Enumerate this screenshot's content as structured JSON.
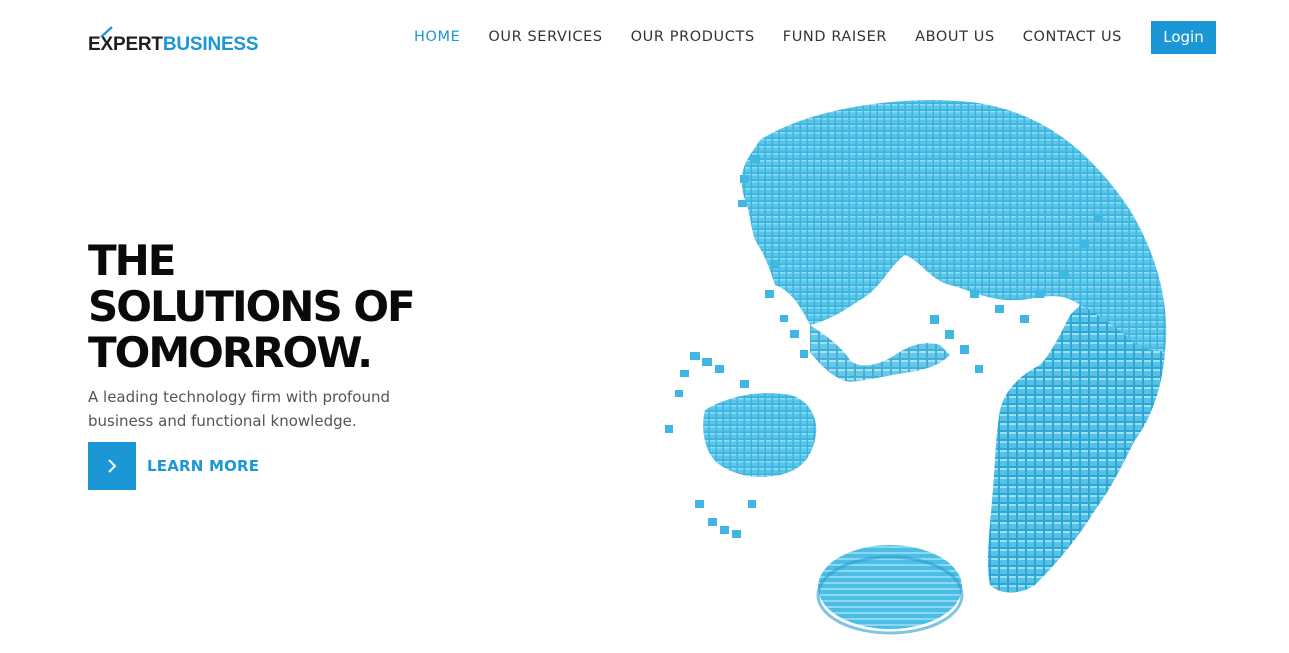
{
  "brand": {
    "logo_prefix_e": "E",
    "logo_prefix_x": "X",
    "logo_prefix_rest": "PERT",
    "logo_suffix": "BUSINESS",
    "colors": {
      "primary": "#1a97d4",
      "dark": "#1f1f1f"
    }
  },
  "nav": {
    "items": [
      {
        "label": "HOME",
        "active": true
      },
      {
        "label": "OUR SERVICES",
        "active": false
      },
      {
        "label": "OUR PRODUCTS",
        "active": false
      },
      {
        "label": "FUND RAISER",
        "active": false
      },
      {
        "label": "ABOUT US",
        "active": false
      },
      {
        "label": "CONTACT US",
        "active": false
      }
    ],
    "login_label": "Login"
  },
  "hero": {
    "title_lines": [
      "THE",
      "SOLUTIONS OF",
      "TOMORROW."
    ],
    "subtitle": "A leading technology firm with profound business and functional knowledge.",
    "cta_label": "LEARN MORE",
    "cta_icon": "chevron-right-icon",
    "image": "voxel-globe-illustration"
  }
}
